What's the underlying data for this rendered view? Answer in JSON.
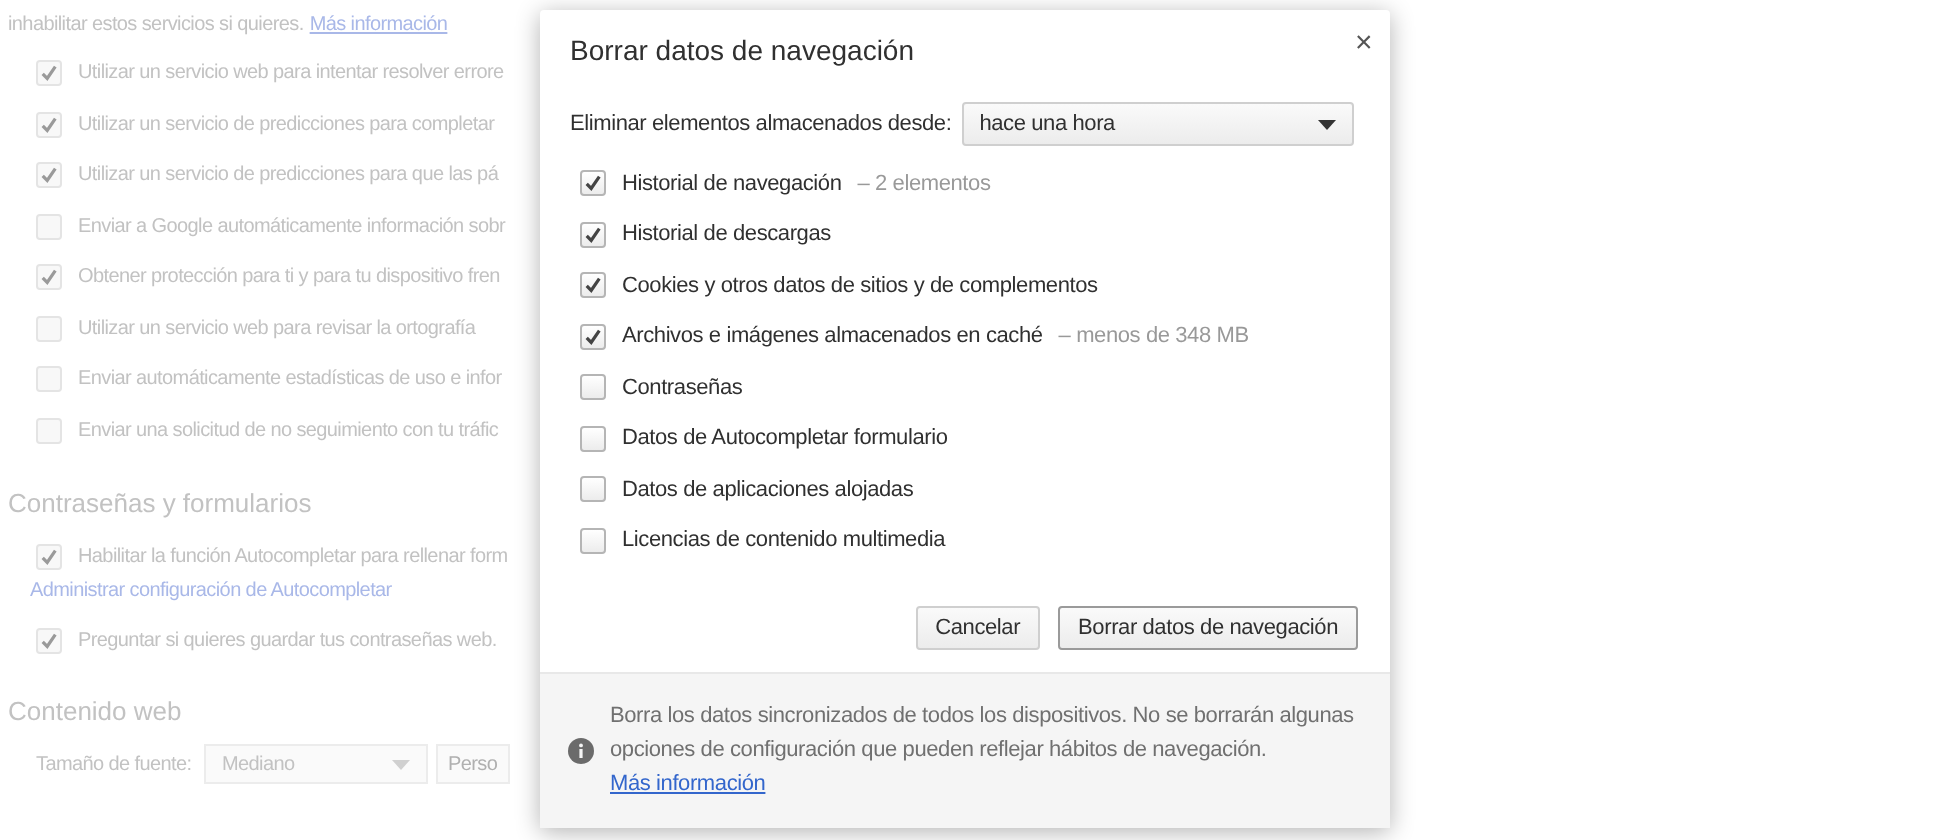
{
  "background": {
    "intro": "inhabilitar estos servicios si quieres.",
    "intro_link": "Más información",
    "privacy_options": [
      {
        "label": "Utilizar un servicio web para intentar resolver errore",
        "checked": true
      },
      {
        "label": "Utilizar un servicio de predicciones para completar",
        "checked": true
      },
      {
        "label": "Utilizar un servicio de predicciones para que las pá",
        "checked": true
      },
      {
        "label": "Enviar a Google automáticamente información sobr",
        "checked": false
      },
      {
        "label": "Obtener protección para ti y para tu dispositivo fren",
        "checked": true
      },
      {
        "label": "Utilizar un servicio web para revisar la ortografía",
        "checked": false
      },
      {
        "label": "Enviar automáticamente estadísticas de uso e infor",
        "checked": false
      },
      {
        "label": "Enviar una solicitud de no seguimiento con tu tráfic",
        "checked": false
      }
    ],
    "passwords_heading": "Contraseñas y formularios",
    "autofill_option": {
      "label": "Habilitar la función Autocompletar para rellenar form",
      "checked": true
    },
    "autofill_link": "Administrar configuración de Autocompletar",
    "save_passwords_option": {
      "label": "Preguntar si quieres guardar tus contraseñas web.",
      "checked": true
    },
    "web_content_heading": "Contenido web",
    "font_size_label": "Tamaño de fuente:",
    "font_size_value": "Mediano",
    "customize_button": "Perso"
  },
  "dialog": {
    "title": "Borrar datos de navegación",
    "close": "×",
    "range_label": "Eliminar elementos almacenados desde:",
    "range_value": "hace una hora",
    "items": [
      {
        "label": "Historial de navegación",
        "detail": "– 2 elementos",
        "checked": true
      },
      {
        "label": "Historial de descargas",
        "checked": true
      },
      {
        "label": "Cookies y otros datos de sitios y de complementos",
        "checked": true
      },
      {
        "label": "Archivos e imágenes almacenados en caché",
        "detail": "– menos de 348 MB",
        "checked": true
      },
      {
        "label": "Contraseñas",
        "checked": false
      },
      {
        "label": "Datos de Autocompletar formulario",
        "checked": false
      },
      {
        "label": "Datos de aplicaciones alojadas",
        "checked": false
      },
      {
        "label": "Licencias de contenido multimedia",
        "checked": false
      }
    ],
    "buttons": [
      "Cancelar",
      "Borrar datos de navegación"
    ],
    "footer_text": "Borra los datos sincronizados de todos los dispositivos. No se borrarán algunas opciones de configuración que pueden reflejar hábitos de navegación.",
    "footer_link": "Más información"
  }
}
